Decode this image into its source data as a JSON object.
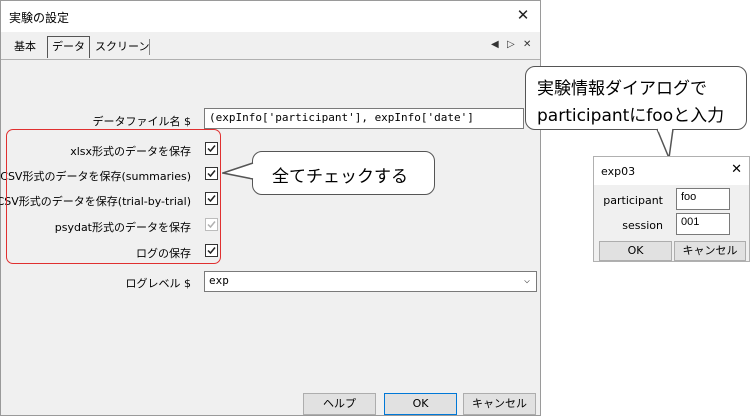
{
  "dialog": {
    "title": "実験の設定",
    "tabs": [
      "基本",
      "データ",
      "スクリーン"
    ],
    "fields": {
      "data_filename_label": "データファイル名 $",
      "data_filename_value": "(expInfo['participant'], expInfo['date']",
      "log_level_label": "ログレベル $",
      "log_level_value": "exp"
    },
    "checkboxes": [
      {
        "label": "xlsx形式のデータを保存",
        "checked": true,
        "disabled": false
      },
      {
        "label": "CSV形式のデータを保存(summaries)",
        "checked": true,
        "disabled": false
      },
      {
        "label": "CSV形式のデータを保存(trial-by-trial)",
        "checked": true,
        "disabled": false
      },
      {
        "label": "psydat形式のデータを保存",
        "checked": true,
        "disabled": true
      },
      {
        "label": "ログの保存",
        "checked": true,
        "disabled": false
      }
    ],
    "buttons": {
      "help": "ヘルプ",
      "ok": "OK",
      "cancel": "キャンセル"
    }
  },
  "callouts": {
    "check_all": "全てチェックする",
    "info_line1": "実験情報ダイアログで",
    "info_line2": "participantにfooと入力"
  },
  "info_dialog": {
    "title": "exp03",
    "participant_label": "participant",
    "participant_value": "foo",
    "session_label": "session",
    "session_value": "001",
    "ok": "OK",
    "cancel": "キャンセル"
  },
  "colors": {
    "annotation_red": "#e03030",
    "accent_blue": "#0078d7"
  },
  "icons": [
    "close-icon",
    "tab-prev-icon",
    "tab-next-icon",
    "tab-close-icon",
    "dropdown-chevron-icon"
  ]
}
